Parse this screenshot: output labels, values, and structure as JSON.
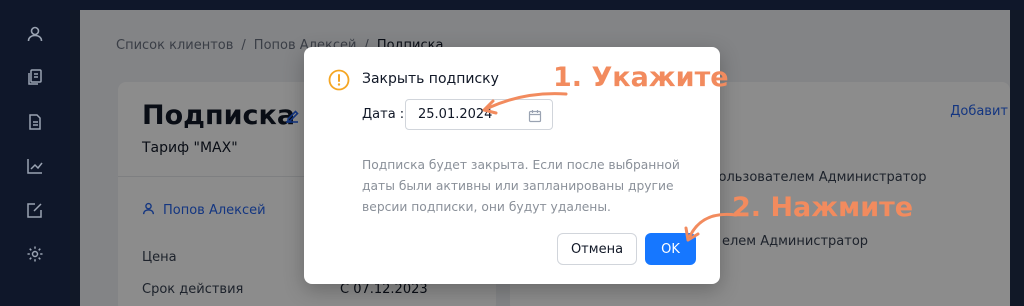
{
  "sidebar": {
    "items": [
      {
        "icon": "user-icon"
      },
      {
        "icon": "documents-icon"
      },
      {
        "icon": "document-icon"
      },
      {
        "icon": "chart-icon"
      },
      {
        "icon": "edit-square-icon"
      },
      {
        "icon": "gear-icon"
      }
    ]
  },
  "breadcrumb": {
    "items": [
      "Список клиентов",
      "Попов Алексей",
      "Подписка"
    ],
    "separator": "/"
  },
  "card": {
    "title": "Подписка",
    "subtitle": "Тариф \"MAX\"",
    "owner": "Попов Алексей",
    "fields": [
      {
        "label": "Цена",
        "value": ""
      },
      {
        "label": "Срок действия",
        "value": "С 07.12.2023"
      }
    ]
  },
  "history": {
    "add_label": "Добавит",
    "rows": [
      "пользователем Администратор",
      "елем Администратор"
    ]
  },
  "modal": {
    "title": "Закрыть подписку",
    "date_label": "Дата :",
    "date_value": "25.01.2024",
    "description": "Подписка будет закрыта. Если после выбранной даты были активны или запланированы другие версии подписки, они будут удалены.",
    "cancel_label": "Отмена",
    "ok_label": "OK"
  },
  "annotations": {
    "step1": "1. Укажите",
    "step2": "2. Нажмите"
  },
  "colors": {
    "accent": "#1677ff",
    "annotation": "#f28b5e",
    "warning": "#f5a623",
    "link": "#2563eb"
  }
}
